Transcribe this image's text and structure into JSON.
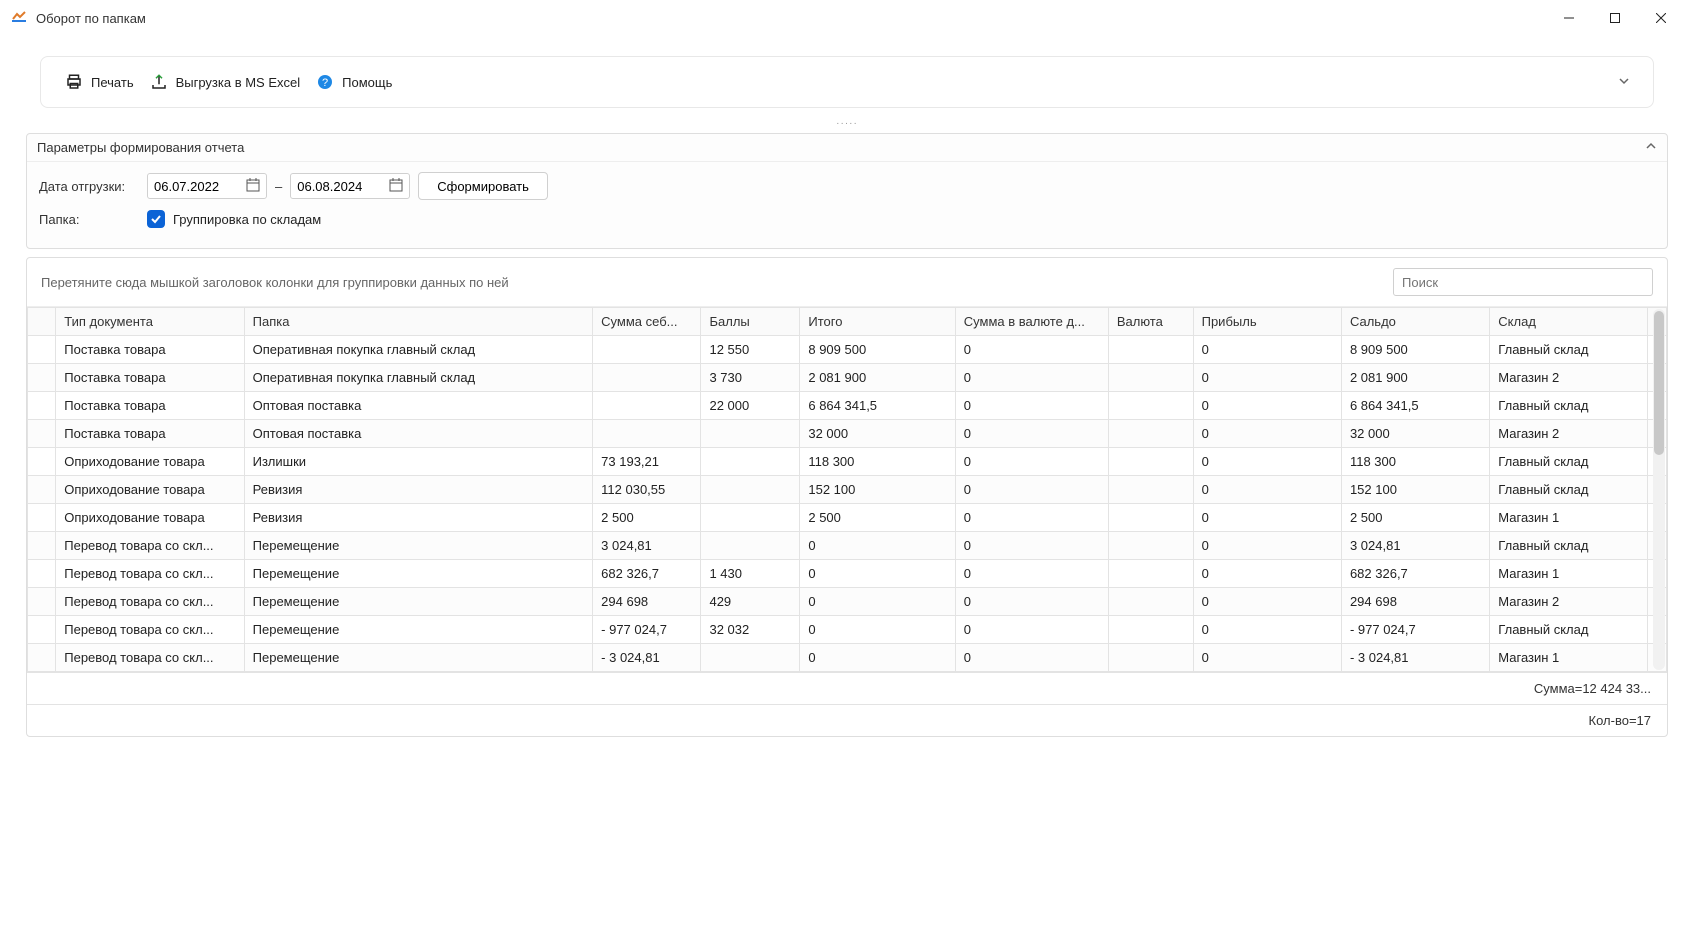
{
  "window": {
    "title": "Оборот по папкам"
  },
  "toolbar": {
    "print": "Печать",
    "export": "Выгрузка в MS Excel",
    "help": "Помощь"
  },
  "params": {
    "header": "Параметры формирования отчета",
    "date_label": "Дата отгрузки:",
    "date_from": "06.07.2022",
    "date_to": "06.08.2024",
    "generate": "Сформировать",
    "folder_label": "Папка:",
    "group_by_warehouse": "Группировка по складам",
    "group_checked": true
  },
  "grid": {
    "group_hint": "Перетяните сюда мышкой заголовок колонки для группировки данных по ней",
    "search_placeholder": "Поиск",
    "columns": [
      "Тип документа",
      "Папка",
      "Сумма себ...",
      "Баллы",
      "Итого",
      "Сумма в валюте д...",
      "Валюта",
      "Прибыль",
      "Сальдо",
      "Склад"
    ],
    "rows": [
      {
        "doc": "Поставка товара",
        "folder": "Оперативная покупка  главный склад",
        "cost": "",
        "points": "12 550",
        "total": "8 909 500",
        "curr_sum": "0",
        "curr": "",
        "profit": "0",
        "balance": "8 909 500",
        "wh": "Главный склад"
      },
      {
        "doc": "Поставка товара",
        "folder": "Оперативная покупка  главный склад",
        "cost": "",
        "points": "3 730",
        "total": "2 081 900",
        "curr_sum": "0",
        "curr": "",
        "profit": "0",
        "balance": "2 081 900",
        "wh": "Магазин 2"
      },
      {
        "doc": "Поставка товара",
        "folder": "Оптовая поставка",
        "cost": "",
        "points": "22 000",
        "total": "6 864 341,5",
        "curr_sum": "0",
        "curr": "",
        "profit": "0",
        "balance": "6 864 341,5",
        "wh": "Главный склад"
      },
      {
        "doc": "Поставка товара",
        "folder": "Оптовая поставка",
        "cost": "",
        "points": "",
        "total": "32 000",
        "curr_sum": "0",
        "curr": "",
        "profit": "0",
        "balance": "32 000",
        "wh": "Магазин 2"
      },
      {
        "doc": "Оприходование товара",
        "folder": "Излишки",
        "cost": "73 193,21",
        "points": "",
        "total": "118 300",
        "curr_sum": "0",
        "curr": "",
        "profit": "0",
        "balance": "118 300",
        "wh": "Главный склад"
      },
      {
        "doc": "Оприходование товара",
        "folder": "Ревизия",
        "cost": "112 030,55",
        "points": "",
        "total": "152 100",
        "curr_sum": "0",
        "curr": "",
        "profit": "0",
        "balance": "152 100",
        "wh": "Главный склад"
      },
      {
        "doc": "Оприходование товара",
        "folder": "Ревизия",
        "cost": "2 500",
        "points": "",
        "total": "2 500",
        "curr_sum": "0",
        "curr": "",
        "profit": "0",
        "balance": "2 500",
        "wh": "Магазин 1"
      },
      {
        "doc": "Перевод товара со скл...",
        "folder": "Перемещение",
        "cost": "3 024,81",
        "points": "",
        "total": "0",
        "curr_sum": "0",
        "curr": "",
        "profit": "0",
        "balance": "3 024,81",
        "wh": "Главный склад"
      },
      {
        "doc": "Перевод товара со скл...",
        "folder": "Перемещение",
        "cost": "682 326,7",
        "points": "1 430",
        "total": "0",
        "curr_sum": "0",
        "curr": "",
        "profit": "0",
        "balance": "682 326,7",
        "wh": "Магазин 1"
      },
      {
        "doc": "Перевод товара со скл...",
        "folder": "Перемещение",
        "cost": "294 698",
        "points": "429",
        "total": "0",
        "curr_sum": "0",
        "curr": "",
        "profit": "0",
        "balance": "294 698",
        "wh": "Магазин 2"
      },
      {
        "doc": "Перевод товара со скл...",
        "folder": "Перемещение",
        "cost": "- 977 024,7",
        "points": "32 032",
        "total": "0",
        "curr_sum": "0",
        "curr": "",
        "profit": "0",
        "balance": "- 977 024,7",
        "wh": "Главный склад"
      },
      {
        "doc": "Перевод товара со скл...",
        "folder": "Перемещение",
        "cost": "- 3 024,81",
        "points": "",
        "total": "0",
        "curr_sum": "0",
        "curr": "",
        "profit": "0",
        "balance": "- 3 024,81",
        "wh": "Магазин 1"
      }
    ],
    "sum_footer": "Сумма=12 424 33...",
    "count_footer": "Кол-во=17"
  }
}
